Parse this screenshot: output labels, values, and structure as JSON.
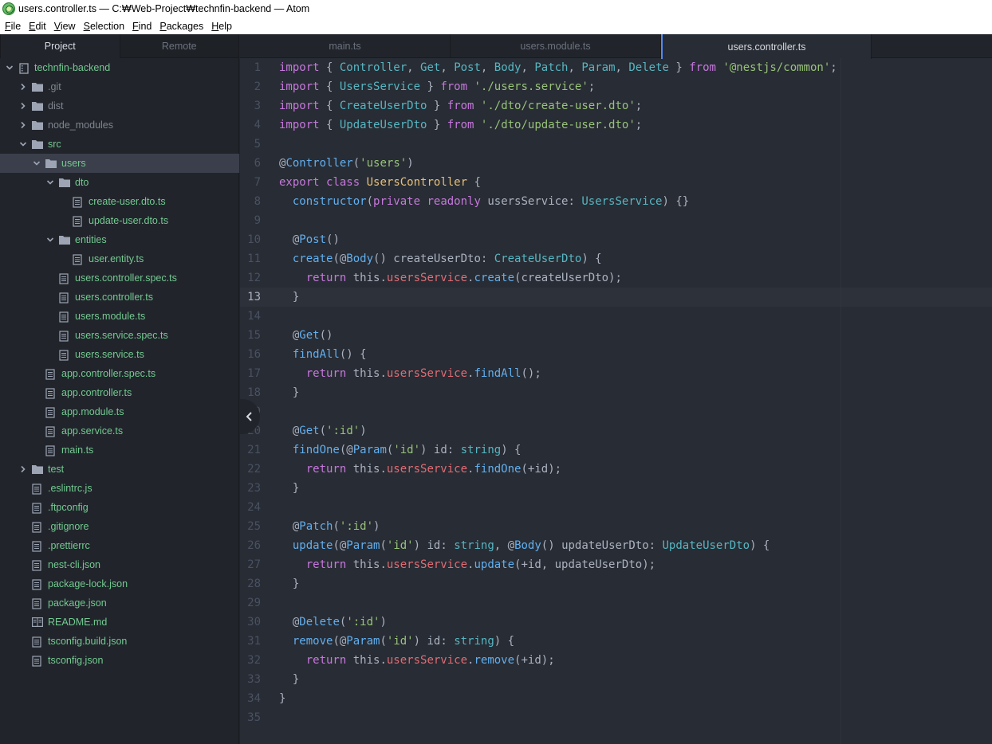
{
  "window": {
    "title": "users.controller.ts — C:₩Web-Project₩technfin-backend — Atom"
  },
  "menu": [
    {
      "label": "File",
      "key": "F",
      "rest": "ile"
    },
    {
      "label": "Edit",
      "key": "E",
      "rest": "dit"
    },
    {
      "label": "View",
      "key": "V",
      "rest": "iew"
    },
    {
      "label": "Selection",
      "key": "S",
      "rest": "election"
    },
    {
      "label": "Find",
      "key": "F",
      "rest": "ind"
    },
    {
      "label": "Packages",
      "key": "P",
      "rest": "ackages"
    },
    {
      "label": "Help",
      "key": "H",
      "rest": "elp"
    }
  ],
  "panel": {
    "tabs": [
      {
        "label": "Project",
        "active": true
      },
      {
        "label": "Remote",
        "active": false
      }
    ],
    "tree": [
      {
        "label": "technfin-backend",
        "depth": 0,
        "type": "repo",
        "chevron": "down"
      },
      {
        "label": ".git",
        "depth": 1,
        "type": "folder",
        "chevron": "right",
        "dim": true
      },
      {
        "label": "dist",
        "depth": 1,
        "type": "folder",
        "chevron": "right",
        "dim": true
      },
      {
        "label": "node_modules",
        "depth": 1,
        "type": "folder",
        "chevron": "right",
        "dim": true
      },
      {
        "label": "src",
        "depth": 1,
        "type": "folder",
        "chevron": "down"
      },
      {
        "label": "users",
        "depth": 2,
        "type": "folder",
        "chevron": "down",
        "selected": true
      },
      {
        "label": "dto",
        "depth": 3,
        "type": "folder",
        "chevron": "down"
      },
      {
        "label": "create-user.dto.ts",
        "depth": 4,
        "type": "file"
      },
      {
        "label": "update-user.dto.ts",
        "depth": 4,
        "type": "file"
      },
      {
        "label": "entities",
        "depth": 3,
        "type": "folder",
        "chevron": "down"
      },
      {
        "label": "user.entity.ts",
        "depth": 4,
        "type": "file"
      },
      {
        "label": "users.controller.spec.ts",
        "depth": 3,
        "type": "file"
      },
      {
        "label": "users.controller.ts",
        "depth": 3,
        "type": "file"
      },
      {
        "label": "users.module.ts",
        "depth": 3,
        "type": "file"
      },
      {
        "label": "users.service.spec.ts",
        "depth": 3,
        "type": "file"
      },
      {
        "label": "users.service.ts",
        "depth": 3,
        "type": "file"
      },
      {
        "label": "app.controller.spec.ts",
        "depth": 2,
        "type": "file"
      },
      {
        "label": "app.controller.ts",
        "depth": 2,
        "type": "file"
      },
      {
        "label": "app.module.ts",
        "depth": 2,
        "type": "file"
      },
      {
        "label": "app.service.ts",
        "depth": 2,
        "type": "file"
      },
      {
        "label": "main.ts",
        "depth": 2,
        "type": "file"
      },
      {
        "label": "test",
        "depth": 1,
        "type": "folder",
        "chevron": "right"
      },
      {
        "label": ".eslintrc.js",
        "depth": 1,
        "type": "file"
      },
      {
        "label": ".ftpconfig",
        "depth": 1,
        "type": "file"
      },
      {
        "label": ".gitignore",
        "depth": 1,
        "type": "file"
      },
      {
        "label": ".prettierrc",
        "depth": 1,
        "type": "file"
      },
      {
        "label": "nest-cli.json",
        "depth": 1,
        "type": "file"
      },
      {
        "label": "package-lock.json",
        "depth": 1,
        "type": "file"
      },
      {
        "label": "package.json",
        "depth": 1,
        "type": "file"
      },
      {
        "label": "README.md",
        "depth": 1,
        "type": "book"
      },
      {
        "label": "tsconfig.build.json",
        "depth": 1,
        "type": "file"
      },
      {
        "label": "tsconfig.json",
        "depth": 1,
        "type": "file"
      }
    ]
  },
  "editor": {
    "tabs": [
      {
        "label": "main.ts",
        "active": false
      },
      {
        "label": "users.module.ts",
        "active": false
      },
      {
        "label": "users.controller.ts",
        "active": true
      }
    ],
    "cursor_line": 13,
    "lines": [
      [
        [
          "k",
          "import"
        ],
        [
          "n",
          " { "
        ],
        [
          "t",
          "Controller"
        ],
        [
          "n",
          ", "
        ],
        [
          "t",
          "Get"
        ],
        [
          "n",
          ", "
        ],
        [
          "t",
          "Post"
        ],
        [
          "n",
          ", "
        ],
        [
          "t",
          "Body"
        ],
        [
          "n",
          ", "
        ],
        [
          "t",
          "Patch"
        ],
        [
          "n",
          ", "
        ],
        [
          "t",
          "Param"
        ],
        [
          "n",
          ", "
        ],
        [
          "t",
          "Delete"
        ],
        [
          "n",
          " } "
        ],
        [
          "k",
          "from"
        ],
        [
          "n",
          " "
        ],
        [
          "s",
          "'@nestjs/common'"
        ],
        [
          "n",
          ";"
        ]
      ],
      [
        [
          "k",
          "import"
        ],
        [
          "n",
          " { "
        ],
        [
          "t",
          "UsersService"
        ],
        [
          "n",
          " } "
        ],
        [
          "k",
          "from"
        ],
        [
          "n",
          " "
        ],
        [
          "s",
          "'./users.service'"
        ],
        [
          "n",
          ";"
        ]
      ],
      [
        [
          "k",
          "import"
        ],
        [
          "n",
          " { "
        ],
        [
          "t",
          "CreateUserDto"
        ],
        [
          "n",
          " } "
        ],
        [
          "k",
          "from"
        ],
        [
          "n",
          " "
        ],
        [
          "s",
          "'./dto/create-user.dto'"
        ],
        [
          "n",
          ";"
        ]
      ],
      [
        [
          "k",
          "import"
        ],
        [
          "n",
          " { "
        ],
        [
          "t",
          "UpdateUserDto"
        ],
        [
          "n",
          " } "
        ],
        [
          "k",
          "from"
        ],
        [
          "n",
          " "
        ],
        [
          "s",
          "'./dto/update-user.dto'"
        ],
        [
          "n",
          ";"
        ]
      ],
      [],
      [
        [
          "n",
          "@"
        ],
        [
          "f",
          "Controller"
        ],
        [
          "n",
          "("
        ],
        [
          "s",
          "'users'"
        ],
        [
          "n",
          ")"
        ]
      ],
      [
        [
          "k",
          "export"
        ],
        [
          "n",
          " "
        ],
        [
          "k",
          "class"
        ],
        [
          "n",
          " "
        ],
        [
          "c",
          "UsersController"
        ],
        [
          "n",
          " {"
        ]
      ],
      [
        [
          "n",
          "  "
        ],
        [
          "f",
          "constructor"
        ],
        [
          "n",
          "("
        ],
        [
          "k",
          "private"
        ],
        [
          "n",
          " "
        ],
        [
          "k",
          "readonly"
        ],
        [
          "n",
          " usersService: "
        ],
        [
          "t",
          "UsersService"
        ],
        [
          "n",
          ") {}"
        ]
      ],
      [],
      [
        [
          "n",
          "  @"
        ],
        [
          "f",
          "Post"
        ],
        [
          "n",
          "()"
        ]
      ],
      [
        [
          "n",
          "  "
        ],
        [
          "f",
          "create"
        ],
        [
          "n",
          "(@"
        ],
        [
          "f",
          "Body"
        ],
        [
          "n",
          "() createUserDto: "
        ],
        [
          "t",
          "CreateUserDto"
        ],
        [
          "n",
          ") {"
        ]
      ],
      [
        [
          "n",
          "    "
        ],
        [
          "k",
          "return"
        ],
        [
          "n",
          " this."
        ],
        [
          "p",
          "usersService"
        ],
        [
          "n",
          "."
        ],
        [
          "f",
          "create"
        ],
        [
          "n",
          "(createUserDto);"
        ]
      ],
      [
        [
          "n",
          "  }"
        ]
      ],
      [],
      [
        [
          "n",
          "  @"
        ],
        [
          "f",
          "Get"
        ],
        [
          "n",
          "()"
        ]
      ],
      [
        [
          "n",
          "  "
        ],
        [
          "f",
          "findAll"
        ],
        [
          "n",
          "() {"
        ]
      ],
      [
        [
          "n",
          "    "
        ],
        [
          "k",
          "return"
        ],
        [
          "n",
          " this."
        ],
        [
          "p",
          "usersService"
        ],
        [
          "n",
          "."
        ],
        [
          "f",
          "findAll"
        ],
        [
          "n",
          "();"
        ]
      ],
      [
        [
          "n",
          "  }"
        ]
      ],
      [],
      [
        [
          "n",
          "  @"
        ],
        [
          "f",
          "Get"
        ],
        [
          "n",
          "("
        ],
        [
          "s",
          "':id'"
        ],
        [
          "n",
          ")"
        ]
      ],
      [
        [
          "n",
          "  "
        ],
        [
          "f",
          "findOne"
        ],
        [
          "n",
          "(@"
        ],
        [
          "f",
          "Param"
        ],
        [
          "n",
          "("
        ],
        [
          "s",
          "'id'"
        ],
        [
          "n",
          ") id: "
        ],
        [
          "t",
          "string"
        ],
        [
          "n",
          ") {"
        ]
      ],
      [
        [
          "n",
          "    "
        ],
        [
          "k",
          "return"
        ],
        [
          "n",
          " this."
        ],
        [
          "p",
          "usersService"
        ],
        [
          "n",
          "."
        ],
        [
          "f",
          "findOne"
        ],
        [
          "n",
          "(+id);"
        ]
      ],
      [
        [
          "n",
          "  }"
        ]
      ],
      [],
      [
        [
          "n",
          "  @"
        ],
        [
          "f",
          "Patch"
        ],
        [
          "n",
          "("
        ],
        [
          "s",
          "':id'"
        ],
        [
          "n",
          ")"
        ]
      ],
      [
        [
          "n",
          "  "
        ],
        [
          "f",
          "update"
        ],
        [
          "n",
          "(@"
        ],
        [
          "f",
          "Param"
        ],
        [
          "n",
          "("
        ],
        [
          "s",
          "'id'"
        ],
        [
          "n",
          ") id: "
        ],
        [
          "t",
          "string"
        ],
        [
          "n",
          ", @"
        ],
        [
          "f",
          "Body"
        ],
        [
          "n",
          "() updateUserDto: "
        ],
        [
          "t",
          "UpdateUserDto"
        ],
        [
          "n",
          ") {"
        ]
      ],
      [
        [
          "n",
          "    "
        ],
        [
          "k",
          "return"
        ],
        [
          "n",
          " this."
        ],
        [
          "p",
          "usersService"
        ],
        [
          "n",
          "."
        ],
        [
          "f",
          "update"
        ],
        [
          "n",
          "(+id, updateUserDto);"
        ]
      ],
      [
        [
          "n",
          "  }"
        ]
      ],
      [],
      [
        [
          "n",
          "  @"
        ],
        [
          "f",
          "Delete"
        ],
        [
          "n",
          "("
        ],
        [
          "s",
          "':id'"
        ],
        [
          "n",
          ")"
        ]
      ],
      [
        [
          "n",
          "  "
        ],
        [
          "f",
          "remove"
        ],
        [
          "n",
          "(@"
        ],
        [
          "f",
          "Param"
        ],
        [
          "n",
          "("
        ],
        [
          "s",
          "'id'"
        ],
        [
          "n",
          ") id: "
        ],
        [
          "t",
          "string"
        ],
        [
          "n",
          ") {"
        ]
      ],
      [
        [
          "n",
          "    "
        ],
        [
          "k",
          "return"
        ],
        [
          "n",
          " this."
        ],
        [
          "p",
          "usersService"
        ],
        [
          "n",
          "."
        ],
        [
          "f",
          "remove"
        ],
        [
          "n",
          "(+id);"
        ]
      ],
      [
        [
          "n",
          "  }"
        ]
      ],
      [
        [
          "n",
          "}"
        ]
      ],
      []
    ]
  },
  "colors": {
    "folder": "#9da5b4",
    "file_modified": "#73c991",
    "accent": "#568af2"
  }
}
